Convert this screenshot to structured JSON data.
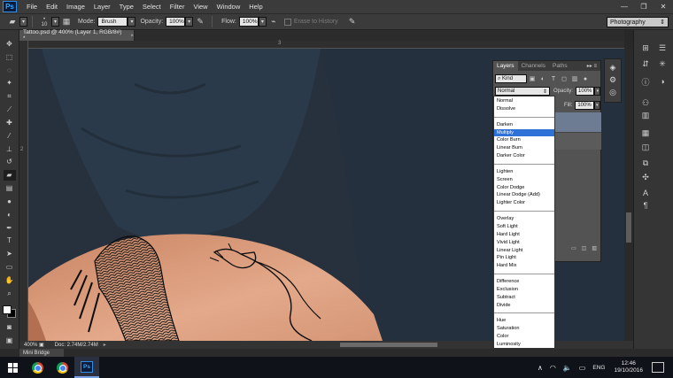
{
  "app": {
    "logo": "Ps"
  },
  "menu": [
    "File",
    "Edit",
    "Image",
    "Layer",
    "Type",
    "Select",
    "Filter",
    "View",
    "Window",
    "Help"
  ],
  "options": {
    "brush_size": "10",
    "mode_label": "Mode:",
    "mode_value": "Brush",
    "opacity_label": "Opacity:",
    "opacity_value": "100%",
    "flow_label": "Flow:",
    "flow_value": "100%",
    "erase_history": "Erase to History",
    "workspace": "Photography"
  },
  "document": {
    "tab_title": "Tattoo.psd @ 400% (Layer 1, RGB/8#) *",
    "zoom": "400%",
    "doc_info": "Doc: 2.74M/2.74M",
    "ruler_numbers": [
      "2",
      "3"
    ]
  },
  "layers_panel": {
    "tabs": [
      "Layers",
      "Channels",
      "Paths"
    ],
    "filter_kind": "Kind",
    "blend_mode": "Normal",
    "opacity_label": "Opacity:",
    "opacity_value": "100%",
    "fill_label": "Fill:",
    "fill_value": "100%"
  },
  "blend_modes": [
    [
      "Normal",
      "Dissolve"
    ],
    [
      "Darken",
      "Multiply",
      "Color Burn",
      "Linear Burn",
      "Darker Color"
    ],
    [
      "Lighten",
      "Screen",
      "Color Dodge",
      "Linear Dodge (Add)",
      "Lighter Color"
    ],
    [
      "Overlay",
      "Soft Light",
      "Hard Light",
      "Vivid Light",
      "Linear Light",
      "Pin Light",
      "Hard Mix"
    ],
    [
      "Difference",
      "Exclusion",
      "Subtract",
      "Divide"
    ],
    [
      "Hue",
      "Saturation",
      "Color",
      "Luminosity"
    ]
  ],
  "blend_selected": "Multiply",
  "mini_bridge": "Mini Bridge",
  "taskbar": {
    "language": "ENG",
    "time": "12:46",
    "date": "19/10/2016"
  },
  "colors": {
    "selection": "#3071d8",
    "shirt": "#273544",
    "skin": "#d99a7c",
    "ink": "#101010"
  }
}
